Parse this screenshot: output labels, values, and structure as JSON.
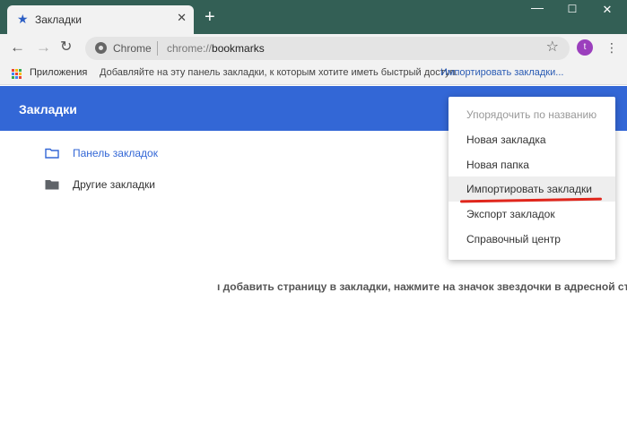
{
  "tab": {
    "title": "Закладки",
    "close": "✕",
    "new_tab": "+"
  },
  "window": {
    "minimize": "—",
    "maximize": "☐",
    "close": "✕"
  },
  "toolbar": {
    "back": "←",
    "forward": "→",
    "reload": "↻",
    "omnibox_label": "Chrome",
    "url_scheme": "chrome://",
    "url_path": "bookmarks",
    "star": "☆",
    "avatar_letter": "t",
    "menu": "⋮"
  },
  "bookmarks_bar": {
    "apps": "Приложения",
    "hint": "Добавляйте на эту панель закладки, к которым хотите иметь быстрый доступ.",
    "import_link": "Импортировать закладки..."
  },
  "header": {
    "title": "Закладки"
  },
  "folders": [
    {
      "label": "Панель закладок",
      "icon": "folder-outline-icon"
    },
    {
      "label": "Другие закладки",
      "icon": "folder-filled-icon"
    }
  ],
  "empty_message": "ı добавить страницу в закладки, нажмите на значок звездочки в адресной строке",
  "menu": {
    "items": [
      {
        "label": "Упорядочить по названию",
        "disabled": true
      },
      {
        "label": "Новая закладка"
      },
      {
        "label": "Новая папка"
      },
      {
        "label": "Импортировать закладки",
        "highlighted": true
      },
      {
        "label": "Экспорт закладок"
      },
      {
        "label": "Справочный центр"
      }
    ]
  },
  "colors": {
    "titlebar": "#335f55",
    "header": "#3367d6",
    "accent_link": "#2a5bb4",
    "annotation_underline": "#e0261c",
    "avatar": "#9b3fbd"
  }
}
